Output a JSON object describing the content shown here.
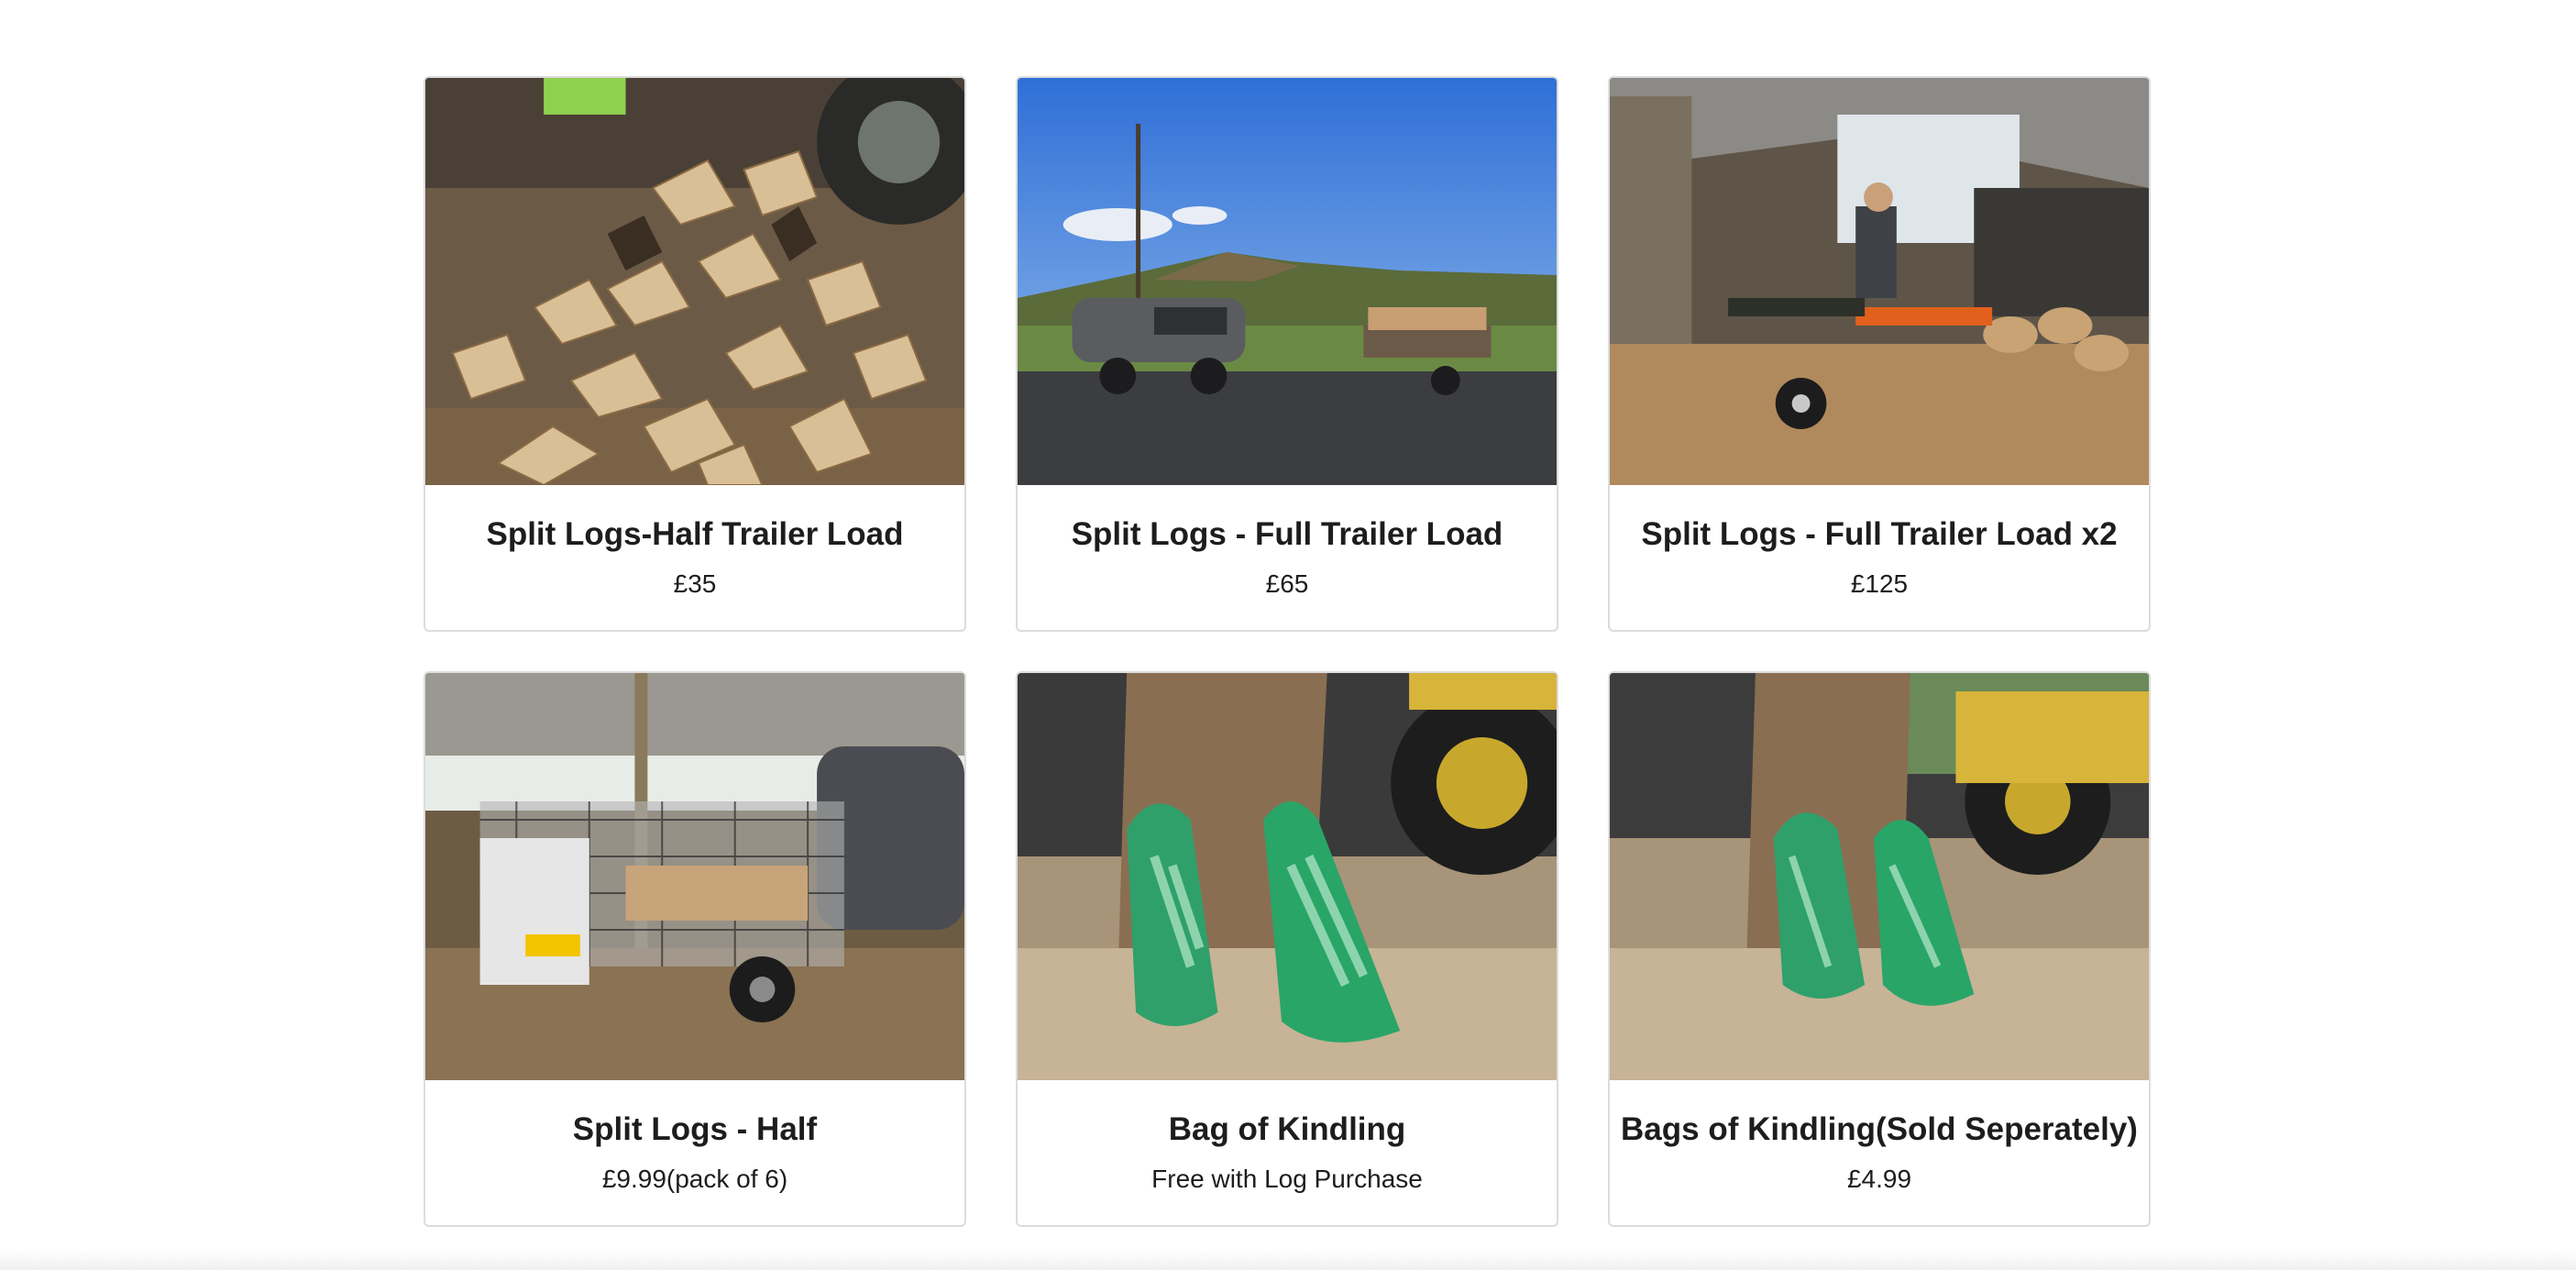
{
  "products": [
    {
      "title": "Split Logs-Half Trailer Load",
      "price": "£35",
      "image_icon": "log-pile-photo"
    },
    {
      "title": "Split Logs - Full Trailer Load",
      "price": "£65",
      "image_icon": "van-trailer-photo"
    },
    {
      "title": "Split Logs - Full Trailer Load x2",
      "price": "£125",
      "image_icon": "log-splitter-photo"
    },
    {
      "title": "Split Logs - Half",
      "price": "£9.99(pack of 6)",
      "image_icon": "trailer-in-barn-photo"
    },
    {
      "title": "Bag of Kindling",
      "price": "Free with Log Purchase",
      "image_icon": "kindling-bags-photo"
    },
    {
      "title": "Bags of Kindling(Sold Seperately)",
      "price": "£4.99",
      "image_icon": "kindling-bags-jcb-photo"
    }
  ]
}
